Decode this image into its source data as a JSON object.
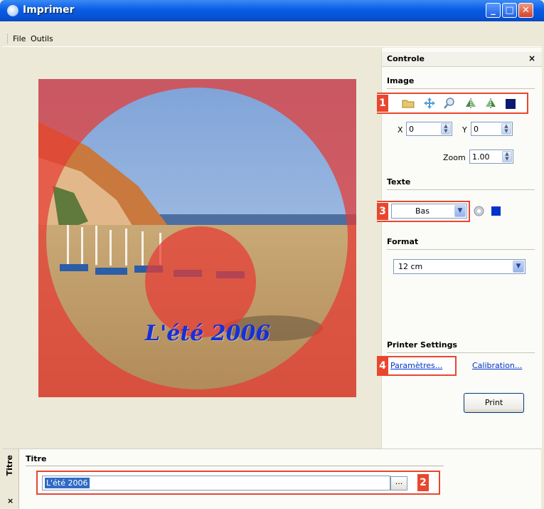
{
  "window": {
    "title": "Imprimer"
  },
  "menu": {
    "items": [
      "File",
      "Outils"
    ]
  },
  "canvas": {
    "photo_title": "L'été 2006"
  },
  "panel": {
    "title": "Controle",
    "close_label": "×",
    "image_section": {
      "title": "Image",
      "tools": [
        "folder-icon",
        "move-icon",
        "zoom-icon",
        "flip-vertical-icon",
        "flip-horizontal-icon",
        "color-swatch-icon"
      ],
      "x_label": "X",
      "x_value": "0",
      "y_label": "Y",
      "y_value": "0",
      "zoom_label": "Zoom",
      "zoom_value": "1.00"
    },
    "text_section": {
      "title": "Texte",
      "position_value": "Bas"
    },
    "format_section": {
      "title": "Format",
      "value": "12 cm"
    },
    "printer_section": {
      "title": "Printer Settings",
      "params_link": "Paramètres...",
      "calibration_link": "Calibration...",
      "print_label": "Print"
    },
    "callouts": [
      "1",
      "2",
      "3",
      "4"
    ]
  },
  "bottom": {
    "tab_label": "Titre",
    "tab_close": "×",
    "section_title": "Titre",
    "title_value": "L'été 2006",
    "browse_label": "..."
  },
  "colors": {
    "accent_red": "#e8472e",
    "swatch_blue": "#0033cc",
    "title_blue": "#1630d9",
    "swatch_navy": "#0a1a6e"
  }
}
